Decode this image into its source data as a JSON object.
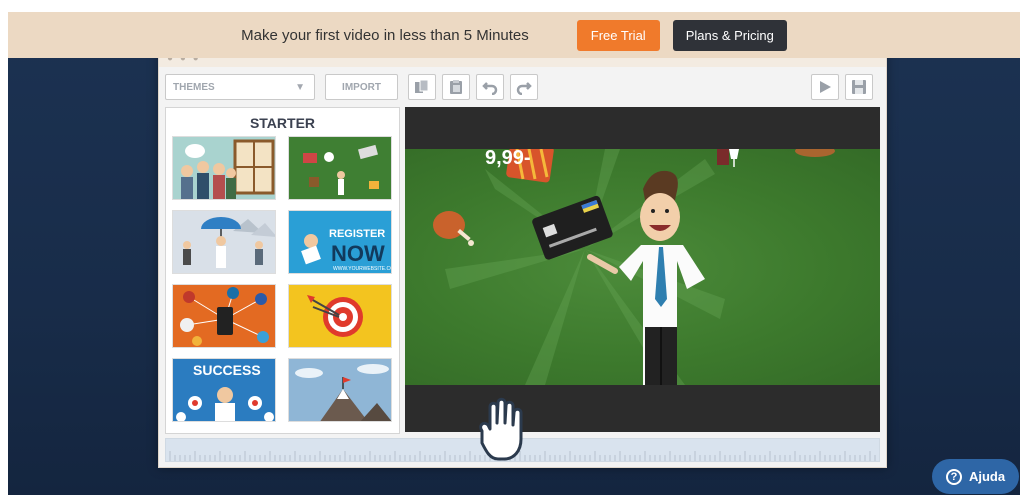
{
  "promo": {
    "text": "Make your first video in less than 5 Minutes",
    "trial_label": "Free Trial",
    "plans_label": "Plans & Pricing"
  },
  "toolbar": {
    "themes_label": "THEMES",
    "import_label": "IMPORT"
  },
  "panel": {
    "title": "STARTER",
    "thumbnails": [
      {
        "caption": ""
      },
      {
        "caption": ""
      },
      {
        "caption": "REGISTER NOW"
      },
      {
        "caption": ""
      },
      {
        "caption": ""
      },
      {
        "caption": "SUCCESS"
      }
    ]
  },
  "stage": {
    "price_text": "9,99-"
  },
  "help": {
    "label": "Ajuda"
  },
  "colors": {
    "accent_orange": "#f07a2b",
    "dark_button": "#2f3238",
    "page_blue": "#1c3252",
    "stage_green": "#3d7a2d",
    "help_blue": "#2e66a6"
  }
}
